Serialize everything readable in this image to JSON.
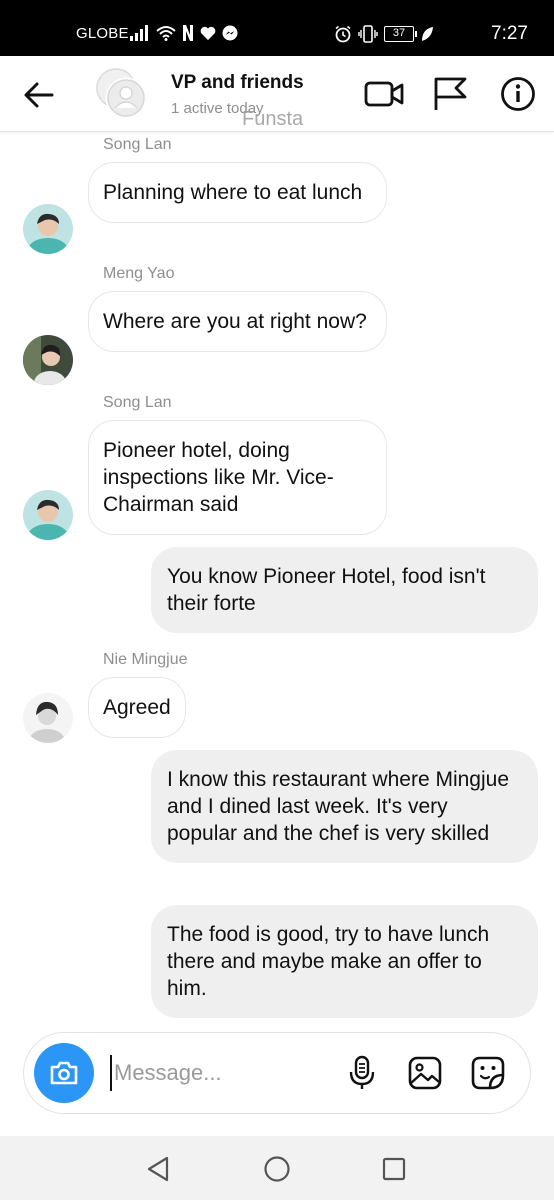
{
  "status_bar": {
    "carrier": "GLOBE",
    "battery": "37",
    "time": "7:27"
  },
  "header": {
    "title": "VP and friends",
    "subtitle": "1 active today",
    "watermark": "Funsta"
  },
  "messages": [
    {
      "sender": "Song Lan",
      "text": "Planning where to eat lunch",
      "direction": "incoming"
    },
    {
      "sender": "Meng Yao",
      "text": "Where are you at right now?",
      "direction": "incoming"
    },
    {
      "sender": "Song Lan",
      "text": "Pioneer hotel, doing inspections like Mr. Vice-Chairman said",
      "direction": "incoming"
    },
    {
      "text": "You know Pioneer Hotel, food isn't their forte",
      "direction": "outgoing"
    },
    {
      "sender": "Nie Mingjue",
      "text": "Agreed",
      "direction": "incoming"
    },
    {
      "text": "I know this restaurant where Mingjue and I dined last week. It's very popular and the chef is very skilled",
      "direction": "outgoing"
    },
    {
      "text": "The food is good, try to have lunch there and maybe make an offer to him.",
      "direction": "outgoing"
    }
  ],
  "composer": {
    "placeholder": "Message..."
  },
  "colors": {
    "accent": "#2b96f5",
    "outgoing_bubble": "#efefef",
    "incoming_border": "#e6e6e6",
    "secondary_text": "#8e8e8e"
  },
  "icons": {
    "header": [
      "back-arrow-icon",
      "video-call-icon",
      "flag-icon",
      "info-icon"
    ],
    "composer": [
      "camera-icon",
      "microphone-icon",
      "gallery-icon",
      "sticker-icon"
    ],
    "nav": [
      "nav-back-icon",
      "nav-home-icon",
      "nav-recents-icon"
    ]
  }
}
